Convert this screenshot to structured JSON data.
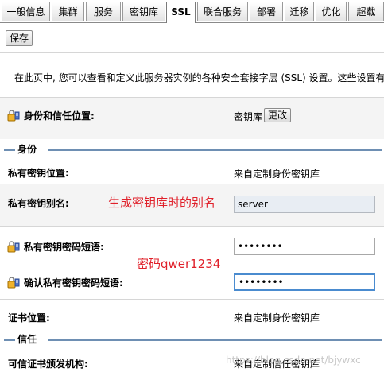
{
  "tabs": [
    {
      "label": "一般信息"
    },
    {
      "label": "集群"
    },
    {
      "label": "服务"
    },
    {
      "label": "密钥库"
    },
    {
      "label": "SSL",
      "active": true
    },
    {
      "label": "联合服务"
    },
    {
      "label": "部署"
    },
    {
      "label": "迁移"
    },
    {
      "label": "优化"
    },
    {
      "label": "超载"
    }
  ],
  "toolbar": {
    "save_label": "保存"
  },
  "description": "在此页中, 您可以查看和定义此服务器实例的各种安全套接字层 (SSL) 设置。这些设置有助",
  "identity_trust": {
    "label": "身份和信任位置:",
    "value": "密钥库",
    "change_label": "更改"
  },
  "identity_section": {
    "title": "身份",
    "private_key_location": {
      "label": "私有密钥位置:",
      "value": "来自定制身份密钥库"
    },
    "private_key_alias": {
      "label": "私有密钥别名:",
      "value": "server"
    },
    "passphrase": {
      "label": "私有密钥密码短语:",
      "value": "••••••••"
    },
    "confirm_passphrase": {
      "label": "确认私有密钥密码短语:",
      "value": "••••••••"
    },
    "cert_location": {
      "label": "证书位置:",
      "value": "来自定制身份密钥库"
    }
  },
  "trust_section": {
    "title": "信任",
    "trusted_ca": {
      "label": "可信证书颁发机构:",
      "value": "来自定制信任密钥库"
    }
  },
  "annotations": {
    "alias_note": "生成密钥库时的别名",
    "password_note": "密码qwer1234"
  },
  "watermark": "https://blog.csdn.net/bjywxc",
  "icon": "config-lock-icon",
  "colors": {
    "annotation": "#e0202a",
    "section_line": "#6e8fb3",
    "focus_border": "#4a8bcf"
  }
}
